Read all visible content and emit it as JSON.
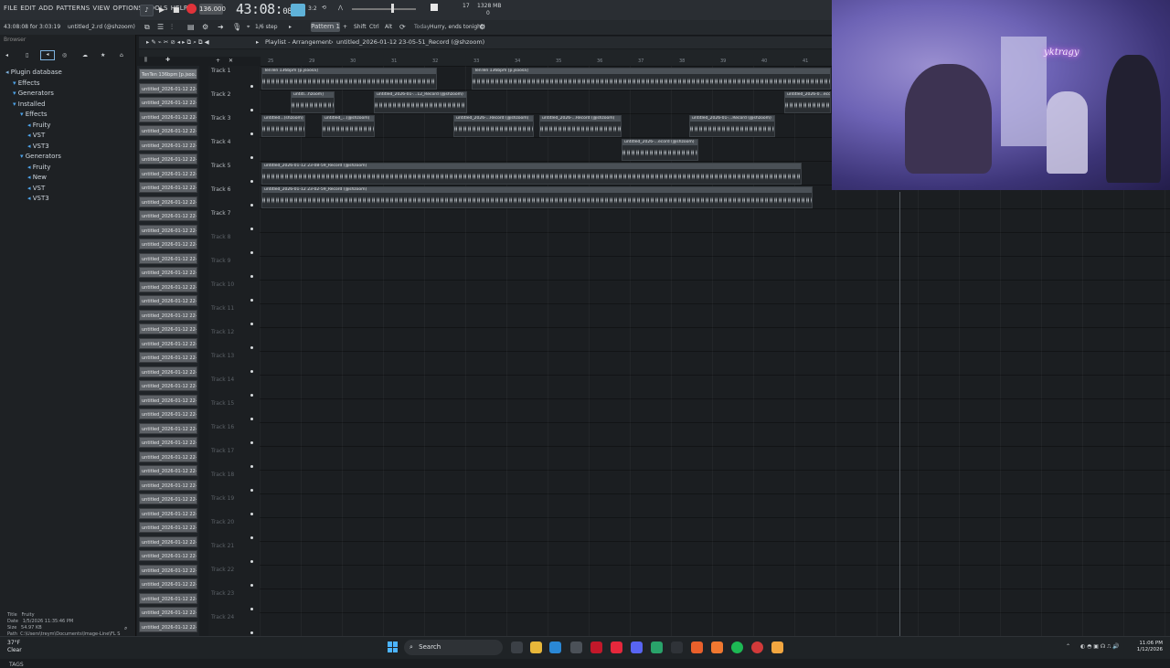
{
  "menubar": {
    "menus": [
      "FILE",
      "EDIT",
      "ADD",
      "PATTERNS",
      "VIEW",
      "OPTIONS",
      "TOOLS",
      "HELP"
    ],
    "tempo": "136.000",
    "timecode_main": "43:08",
    "timecode_sub": "08",
    "time_sig": "3:2",
    "cpu": "17",
    "memory": "1328 MB",
    "mem_sub": "0"
  },
  "status": {
    "left_time": "43:08:08 for 3:03:19",
    "project_file": "untitled_2.rd (@shzoom)"
  },
  "toolbar2": {
    "pattern_label": "Pattern 1",
    "shift": "Shift",
    "ctrl": "Ctrl",
    "alt": "Alt",
    "snap": "1/6 step",
    "hint_label": "Today",
    "hint_text": "Hurry, ends tonight!"
  },
  "browser": {
    "title": "Browser",
    "tree": [
      {
        "label": "Plugin database",
        "indent": 0
      },
      {
        "label": "Effects",
        "indent": 1
      },
      {
        "label": "Generators",
        "indent": 1
      },
      {
        "label": "Installed",
        "indent": 1
      },
      {
        "label": "Effects",
        "indent": 2
      },
      {
        "label": "Fruity",
        "indent": 3
      },
      {
        "label": "VST",
        "indent": 3
      },
      {
        "label": "VST3",
        "indent": 3
      },
      {
        "label": "Generators",
        "indent": 2
      },
      {
        "label": "Fruity",
        "indent": 3
      },
      {
        "label": "New",
        "indent": 3
      },
      {
        "label": "VST",
        "indent": 3
      },
      {
        "label": "VST3",
        "indent": 3
      }
    ],
    "info": {
      "title_label": "Title",
      "title": "Fruity",
      "date_label": "Date",
      "date": "1/5/2026 11:35:46 PM",
      "size_label": "Size",
      "size": "54.97 KB",
      "path_label": "Path",
      "path": "C:\\Users\\treym\\Documents\\Image-Line\\FL Studio\\Presets\\Plugin database\\Installed\\Generators\\Fruity"
    },
    "tags_label": "TAGS"
  },
  "playlist": {
    "title": "Playlist - Arrangement",
    "pattern_name": "untitled_2026-01-12 23-05-51_Record (@shzoom)",
    "picker_first": "TenTen 136bpm [p.jsoo...",
    "picker_item": "untitled_2026-01-12 22-...",
    "ruler": [
      "25",
      "29",
      "30",
      "31",
      "32",
      "33",
      "34",
      "35",
      "36",
      "37",
      "38",
      "39",
      "40",
      "41"
    ],
    "tracks": [
      "Track 1",
      "Track 2",
      "Track 3",
      "Track 4",
      "Track 5",
      "Track 6",
      "Track 7",
      "Track 8",
      "Track 9",
      "Track 10",
      "Track 11",
      "Track 12",
      "Track 13",
      "Track 14",
      "Track 15",
      "Track 16",
      "Track 17",
      "Track 18",
      "Track 19",
      "Track 20",
      "Track 21",
      "Track 22",
      "Track 23",
      "Track 24"
    ],
    "clips": [
      {
        "track": 0,
        "label": "TenTen 136bpm [p.jsoosa]"
      },
      {
        "track": 0,
        "label": "TenTen 136bpm [p.jsoosa]"
      },
      {
        "track": 1,
        "label": "untitl...hzoom]"
      },
      {
        "track": 1,
        "label": "untitled_2026-01-...12_Record (@shzoom)"
      },
      {
        "track": 1,
        "label": "untitled_2026-0...ecord (@sh..."
      },
      {
        "track": 2,
        "label": "untitled...(shzoom)"
      },
      {
        "track": 2,
        "label": "untitled_...(@shzoom)"
      },
      {
        "track": 2,
        "label": "untitled_2026-...Record (@shzoom)"
      },
      {
        "track": 2,
        "label": "untitled_2026-...Record (@shzoom)"
      },
      {
        "track": 2,
        "label": "untitled_2026-01-...Record (@shzoom)"
      },
      {
        "track": 3,
        "label": "untitled_2026-...ecord (@shzoom)"
      },
      {
        "track": 4,
        "label": "untitled_2026-01-12 23-08-59_Record (@shzoom)"
      },
      {
        "track": 5,
        "label": "untitled_2026-01-12 23-02-59_Record (@shzoom)"
      }
    ]
  },
  "webcam": {
    "neon_text": "yktragy"
  },
  "taskbar": {
    "temperature": "37°F",
    "weather": "Clear",
    "search": "Search",
    "time": "11:06 PM",
    "date": "1/12/2026"
  }
}
